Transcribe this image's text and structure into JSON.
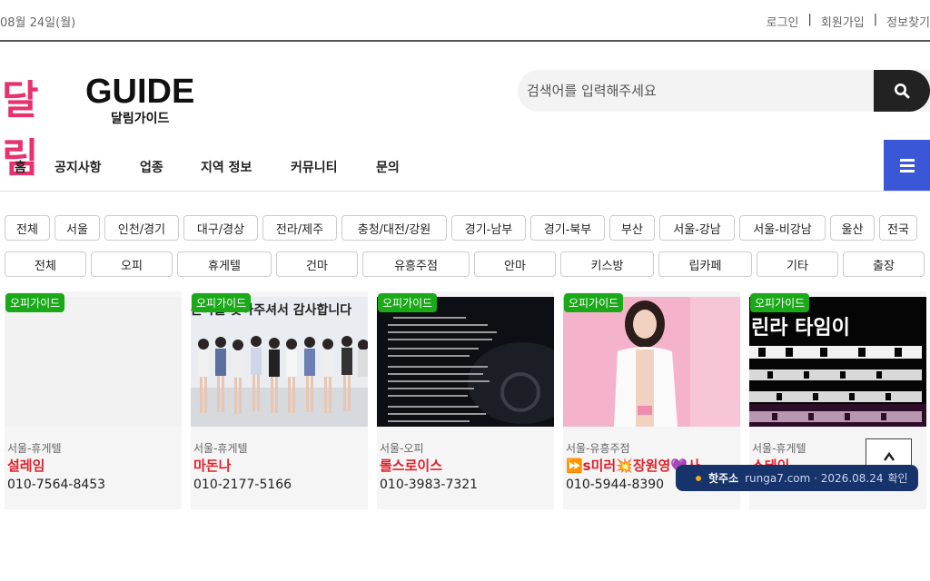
{
  "topbar": {
    "date": "08월 24일(월)",
    "login": "로그인",
    "signup": "회원가입",
    "find": "정보찾기"
  },
  "logo": {
    "ko": "달림",
    "en": "GUIDE",
    "sub": "달림가이드"
  },
  "search": {
    "placeholder": "검색어를 입력해주세요",
    "icon": "search-icon"
  },
  "nav": {
    "items": [
      "홈",
      "공지사항",
      "업종",
      "지역 정보",
      "커뮤니티",
      "문의"
    ]
  },
  "regions": [
    "전체",
    "서울",
    "인천/경기",
    "대구/경상",
    "전라/제주",
    "충청/대전/강원",
    "경기-남부",
    "경기-북부",
    "부산",
    "서울-강남",
    "서울-비강남",
    "울산",
    "전국"
  ],
  "categories": [
    "전체",
    "오피",
    "휴게텔",
    "건마",
    "유흥주점",
    "안마",
    "키스방",
    "립카페",
    "기타",
    "출장"
  ],
  "cards": [
    {
      "badge": "오피가이드",
      "category": "서울-휴게텔",
      "name": "설레임",
      "phone": "010-7564-8453",
      "image_text": ""
    },
    {
      "badge": "오피가이드",
      "category": "서울-휴게텔",
      "name": "마돈나",
      "phone": "010-2177-5166",
      "image_text": "돈나를 찾아주셔서 감사합니다"
    },
    {
      "badge": "오피가이드",
      "category": "서울-오피",
      "name": "롤스로이스",
      "phone": "010-3983-7321",
      "image_text": ""
    },
    {
      "badge": "오피가이드",
      "category": "서울-유흥주점",
      "name": "⏩s미러💥장원영💜사",
      "phone": "010-5944-8390",
      "image_text": ""
    },
    {
      "badge": "오피가이드",
      "category": "서울-휴게텔",
      "name": "스테이",
      "phone": "",
      "image_text": "린라 타임이"
    }
  ],
  "toast": {
    "hot": "핫주소",
    "domain": "runga7.com",
    "date": "2026.08.24",
    "confirm": "확인"
  },
  "colors": {
    "brand": "#e8316f",
    "menu": "#3a57d8",
    "badge": "#1aaa18",
    "toast": "#16336b",
    "price": "#e0202a"
  }
}
